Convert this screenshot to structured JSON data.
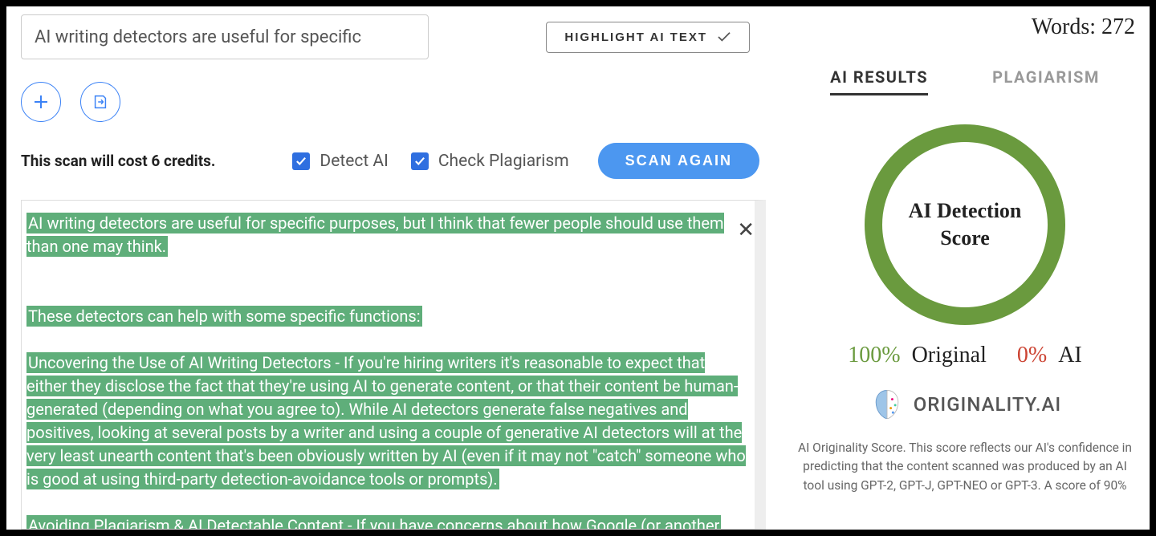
{
  "header": {
    "title_input_value": "AI writing detectors are useful for specific",
    "highlight_label": "HIGHLIGHT AI TEXT"
  },
  "options": {
    "credits_text": "This scan will cost 6 credits.",
    "detect_ai_label": "Detect AI",
    "check_plagiarism_label": "Check Plagiarism",
    "scan_label": "SCAN AGAIN"
  },
  "content": {
    "p1": "AI writing detectors are useful for specific purposes, but I think that fewer people should use them than one may think.",
    "p2": "These detectors can help with some specific functions:",
    "p3": "Uncovering the Use of AI Writing Detectors - If you're hiring writers it's reasonable to expect that either they disclose the fact that they're using AI to generate content, or that their content be human-generated (depending on what you agree to). While AI detectors generate false negatives and positives, looking at several posts by a writer and using a couple of generative AI detectors will at the very least unearth content that's been obviously written by AI (even if it may not \"catch\" someone who is good at using third-party detection-avoidance tools or prompts).",
    "p4": "Avoiding Plagiarism & AI Detectable Content - If you have concerns about how Google (or another"
  },
  "right": {
    "words_label": "Words:",
    "words_count": "272",
    "tab_ai": "AI RESULTS",
    "tab_plag": "PLAGIARISM",
    "score_line1": "AI Detection",
    "score_line2": "Score",
    "pct_original": "100%",
    "label_original": "Original",
    "pct_ai": "0%",
    "label_ai": "AI",
    "brand": "ORIGINALITY.AI",
    "description": "AI Originality Score. This score reflects our AI's confidence in predicting that the content scanned was produced by an AI tool using GPT-2, GPT-J, GPT-NEO or GPT-3. A score of 90%"
  }
}
